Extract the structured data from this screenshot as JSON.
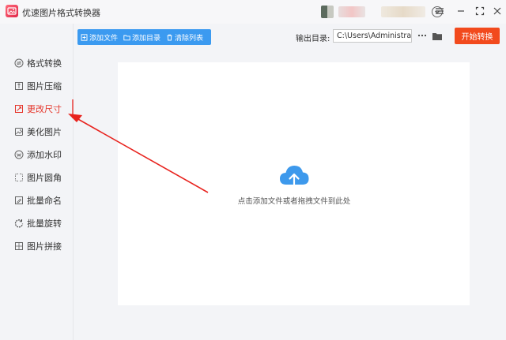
{
  "app": {
    "title": "优速图片格式转换器"
  },
  "colors": {
    "accent_blue": "#3b9af0",
    "start_orange": "#f24a1d",
    "active_red": "#e5352a",
    "annotation_red": "#e8231e",
    "cloud_blue": "#3d99ec"
  },
  "sidebar": {
    "items": [
      {
        "label": "格式转换",
        "icon": "format-convert-icon"
      },
      {
        "label": "图片压缩",
        "icon": "compress-icon"
      },
      {
        "label": "更改尺寸",
        "icon": "resize-icon",
        "active": true
      },
      {
        "label": "美化图片",
        "icon": "beautify-icon"
      },
      {
        "label": "添加水印",
        "icon": "watermark-icon"
      },
      {
        "label": "图片圆角",
        "icon": "rounded-corner-icon"
      },
      {
        "label": "批量命名",
        "icon": "rename-icon"
      },
      {
        "label": "批量旋转",
        "icon": "rotate-icon"
      },
      {
        "label": "图片拼接",
        "icon": "stitch-icon"
      }
    ]
  },
  "toolbar": {
    "add_file": "添加文件",
    "add_folder": "添加目录",
    "clear_list": "清除列表"
  },
  "output": {
    "label": "输出目录:",
    "path": "C:\\Users\\Administrator\\"
  },
  "start_button": "开始转换",
  "dropzone": {
    "hint": "点击添加文件或者拖拽文件到此处",
    "icon": "cloud-upload-icon"
  }
}
